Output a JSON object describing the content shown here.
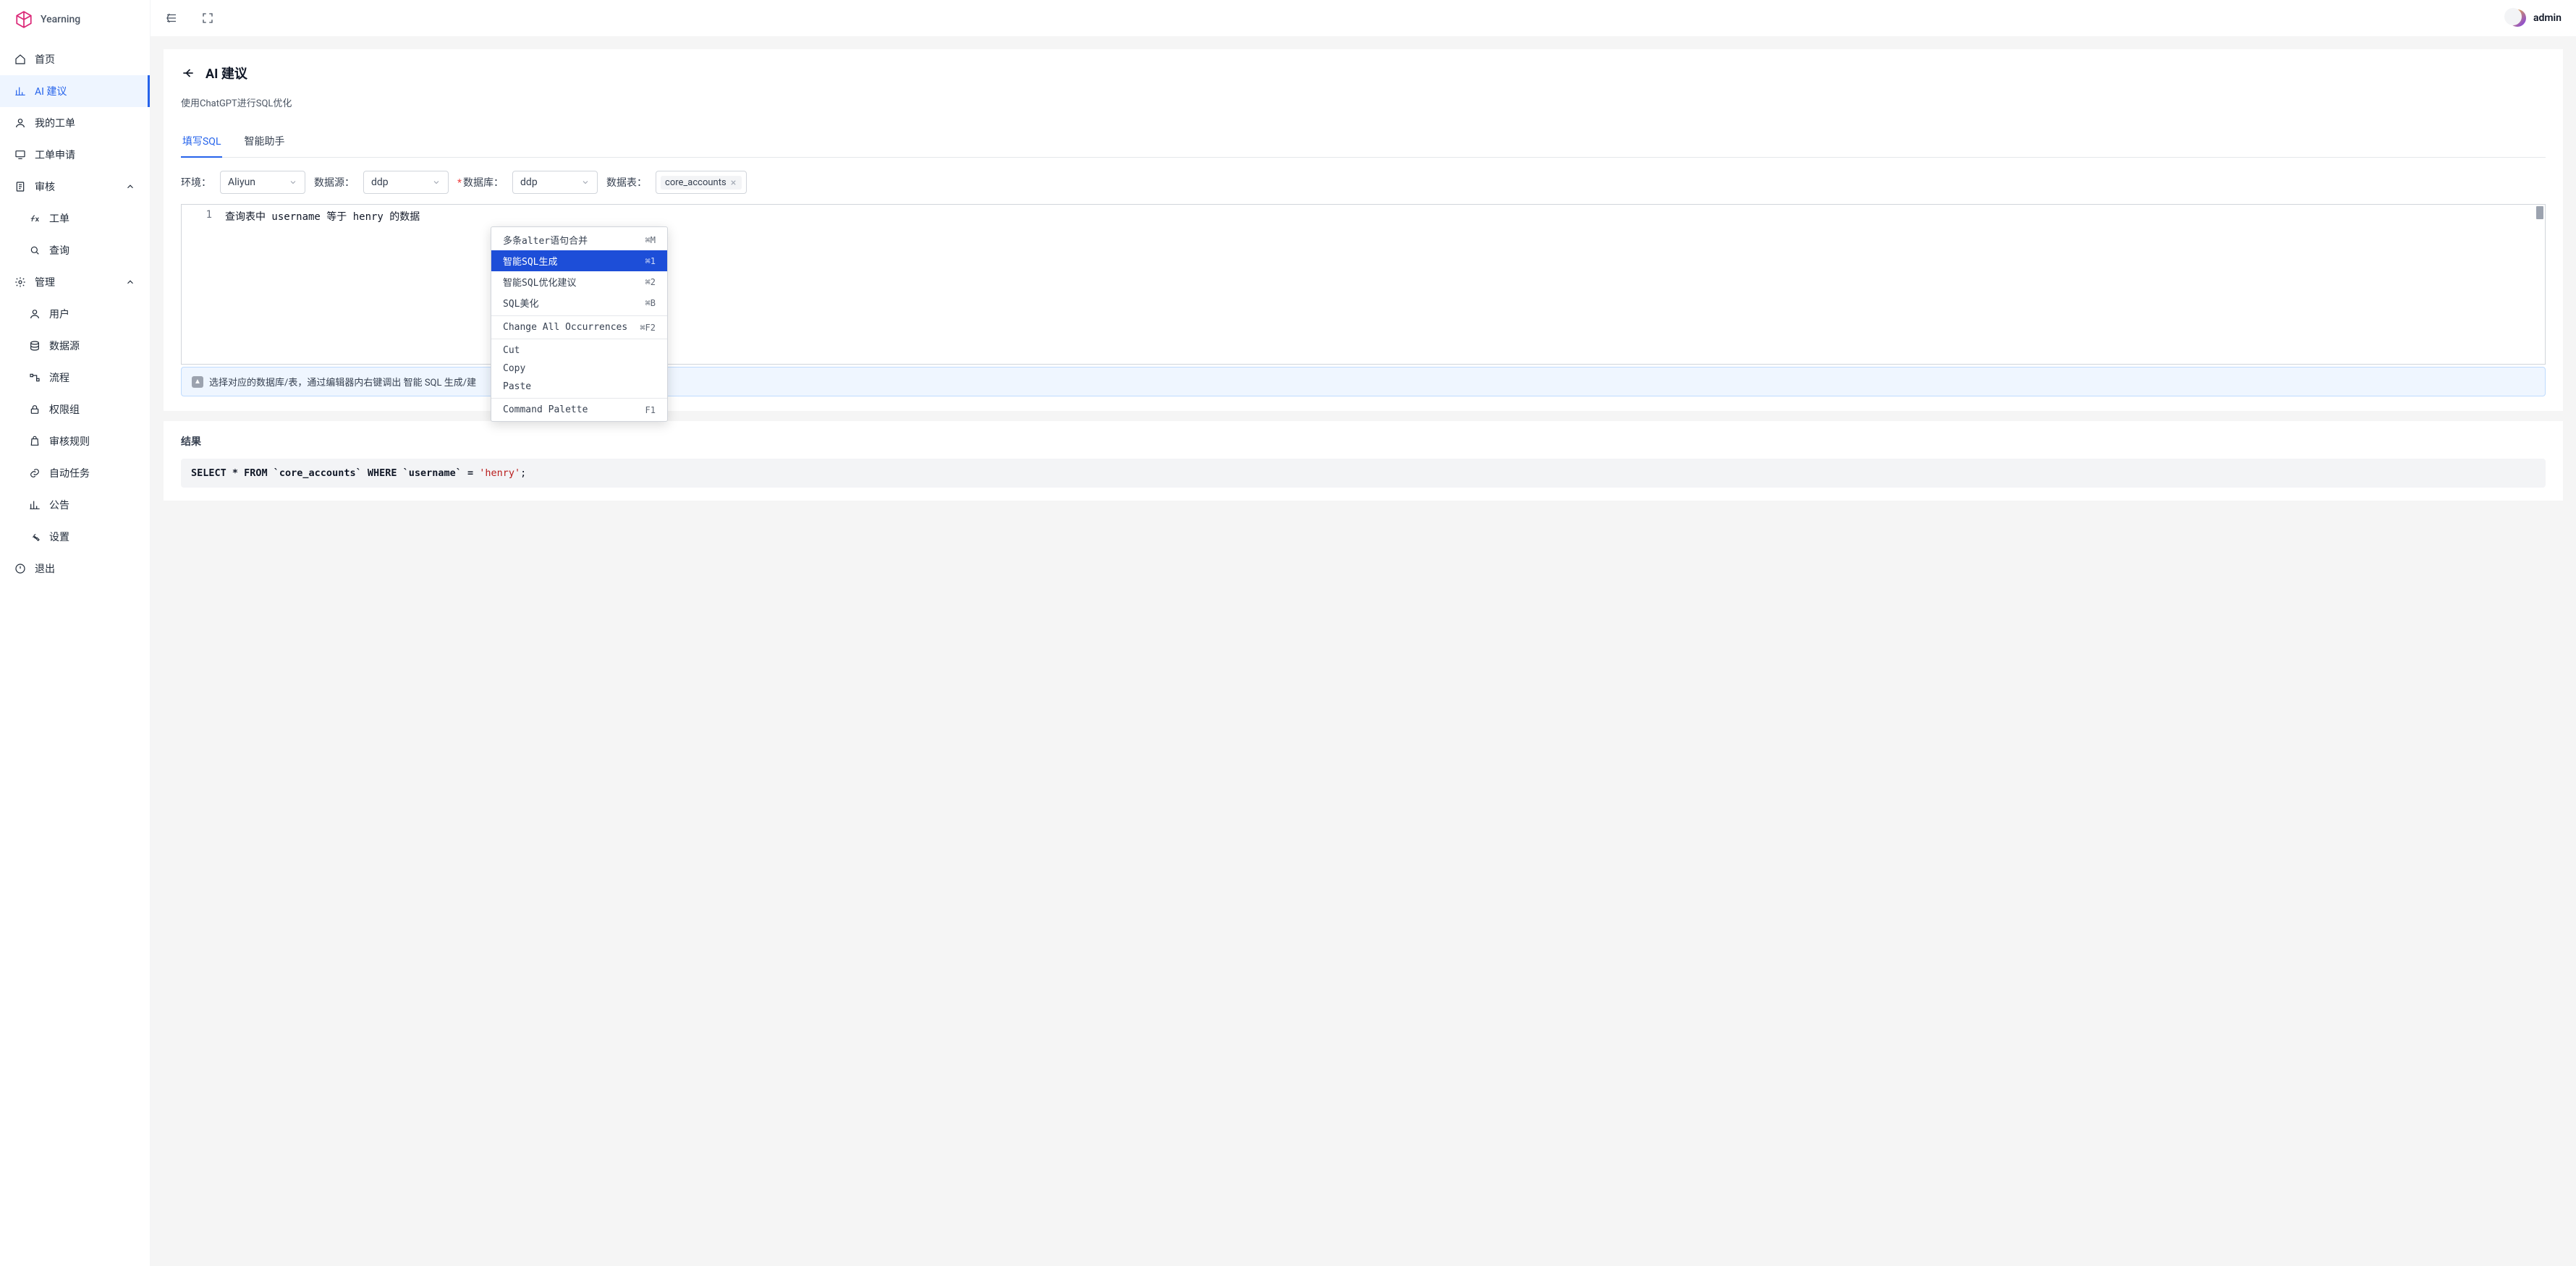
{
  "app": {
    "name": "Yearning"
  },
  "user": {
    "name": "admin"
  },
  "sidebar": {
    "home": "首页",
    "ai": "AI 建议",
    "my_orders": "我的工单",
    "order_apply": "工单申请",
    "audit": "审核",
    "audit_sub_order": "工单",
    "audit_sub_query": "查询",
    "manage": "管理",
    "manage_user": "用户",
    "manage_ds": "数据源",
    "manage_flow": "流程",
    "manage_perm": "权限组",
    "manage_rule": "审核规则",
    "manage_auto": "自动任务",
    "manage_notice": "公告",
    "manage_settings": "设置",
    "logout": "退出"
  },
  "page": {
    "title": "AI 建议",
    "subtitle": "使用ChatGPT进行SQL优化"
  },
  "tabs": {
    "write": "填写SQL",
    "assistant": "智能助手"
  },
  "form": {
    "env_label": "环境：",
    "env_value": "Aliyun",
    "ds_label": "数据源：",
    "ds_value": "ddp",
    "db_label": "数据库：",
    "db_value": "ddp",
    "table_label": "数据表：",
    "table_tag": "core_accounts"
  },
  "editor": {
    "line1_num": "1",
    "line1": "查询表中 username 等于 henry 的数据"
  },
  "context_menu": {
    "merge": {
      "label": "多条alter语句合并",
      "key": "⌘M"
    },
    "gen": {
      "label": "智能SQL生成",
      "key": "⌘1"
    },
    "opt": {
      "label": "智能SQL优化建议",
      "key": "⌘2"
    },
    "fmt": {
      "label": "SQL美化",
      "key": "⌘B"
    },
    "chg": {
      "label": "Change All Occurrences",
      "key": "⌘F2"
    },
    "cut": {
      "label": "Cut"
    },
    "copy": {
      "label": "Copy"
    },
    "paste": {
      "label": "Paste"
    },
    "pal": {
      "label": "Command Palette",
      "key": "F1"
    }
  },
  "hint": "选择对应的数据库/表，通过编辑器内右键调出 智能 SQL 生成/建",
  "result": {
    "title": "结果",
    "sql_prefix": "SELECT * FROM `core_accounts` WHERE `username` = ",
    "sql_str": "'henry'",
    "sql_suffix": ";"
  },
  "watermark": "admin"
}
